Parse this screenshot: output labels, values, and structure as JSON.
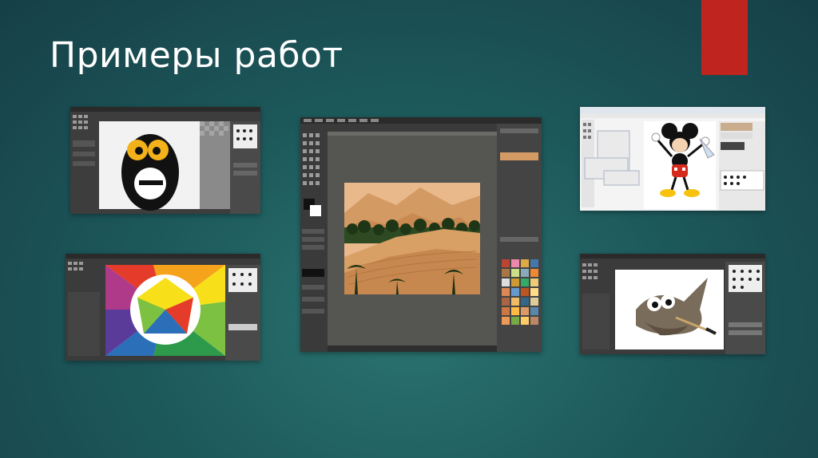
{
  "slide": {
    "title": "Примеры работ",
    "accent_color": "#c0241f",
    "background_color": "#1d5a5c"
  },
  "screenshots": [
    {
      "subject": "e-logo-character",
      "app": "gimp"
    },
    {
      "subject": "color-wheel",
      "app": "gimp"
    },
    {
      "subject": "desert-landscape",
      "app": "gimp"
    },
    {
      "subject": "mickey-mouse",
      "app": "gimp"
    },
    {
      "subject": "gimp-mascot-wilber",
      "app": "gimp"
    }
  ]
}
